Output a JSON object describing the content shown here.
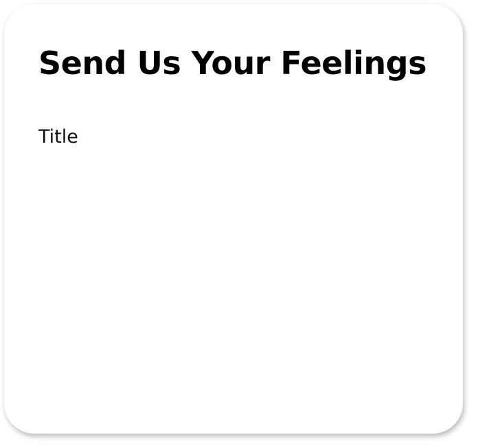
{
  "form": {
    "heading": "Send Us Your Feelings",
    "fields": [
      {
        "label": "Title"
      }
    ]
  }
}
